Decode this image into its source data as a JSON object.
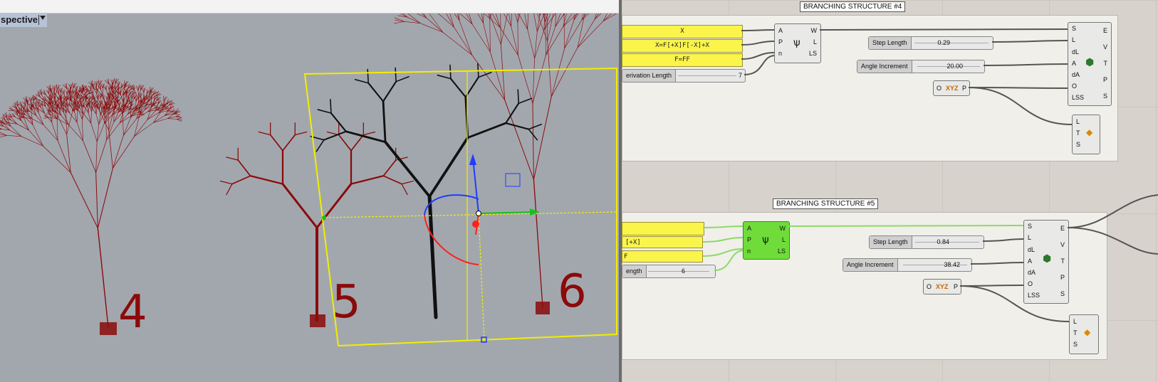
{
  "viewport": {
    "tab_label": "spective",
    "tree_labels": [
      "4",
      "5",
      "6"
    ],
    "colors": {
      "tree_red": "#8b0a0a",
      "selected": "#111111",
      "bbox": "#f2ee00",
      "background": "#a2a7ae"
    }
  },
  "canvas": {
    "groups": [
      {
        "title": "BRANCHING STRUCTURE #4",
        "panels": [
          "X",
          "X=F[+X]F[-X]+X",
          "F=FF"
        ],
        "derivation_slider": {
          "name": "erivation Length",
          "value": "7"
        },
        "lsystem": {
          "inputs": [
            "A",
            "P",
            "n"
          ],
          "outputs": [
            "W",
            "L",
            "LS"
          ]
        },
        "step_slider": {
          "name": "Step Length",
          "value": "0.29"
        },
        "angle_slider": {
          "name": "Angle Increment",
          "value": "20.00"
        },
        "xyz": {
          "in": "O",
          "label": "XYZ",
          "out": "P"
        },
        "turtle": {
          "inputs": [
            "S",
            "L",
            "dL",
            "A",
            "dA",
            "O",
            "LSS"
          ],
          "outputs": [
            "E",
            "V",
            "T",
            "P",
            "S"
          ]
        },
        "goo": {
          "ports": [
            "L",
            "T",
            "S"
          ]
        }
      },
      {
        "title": "BRANCHING STRUCTURE #5",
        "panels": [
          "",
          "[+X]",
          "F"
        ],
        "derivation_slider": {
          "name": "ength",
          "value": "6"
        },
        "lsystem": {
          "inputs": [
            "A",
            "P",
            "n"
          ],
          "outputs": [
            "W",
            "L",
            "LS"
          ]
        },
        "step_slider": {
          "name": "Step Length",
          "value": "0.84"
        },
        "angle_slider": {
          "name": "Angle Increment",
          "value": "38.42"
        },
        "xyz": {
          "in": "O",
          "label": "XYZ",
          "out": "P"
        },
        "turtle": {
          "inputs": [
            "S",
            "L",
            "dL",
            "A",
            "dA",
            "O",
            "LSS"
          ],
          "outputs": [
            "E",
            "V",
            "T",
            "P",
            "S"
          ]
        },
        "goo": {
          "ports": [
            "L",
            "T",
            "S"
          ]
        }
      }
    ]
  }
}
